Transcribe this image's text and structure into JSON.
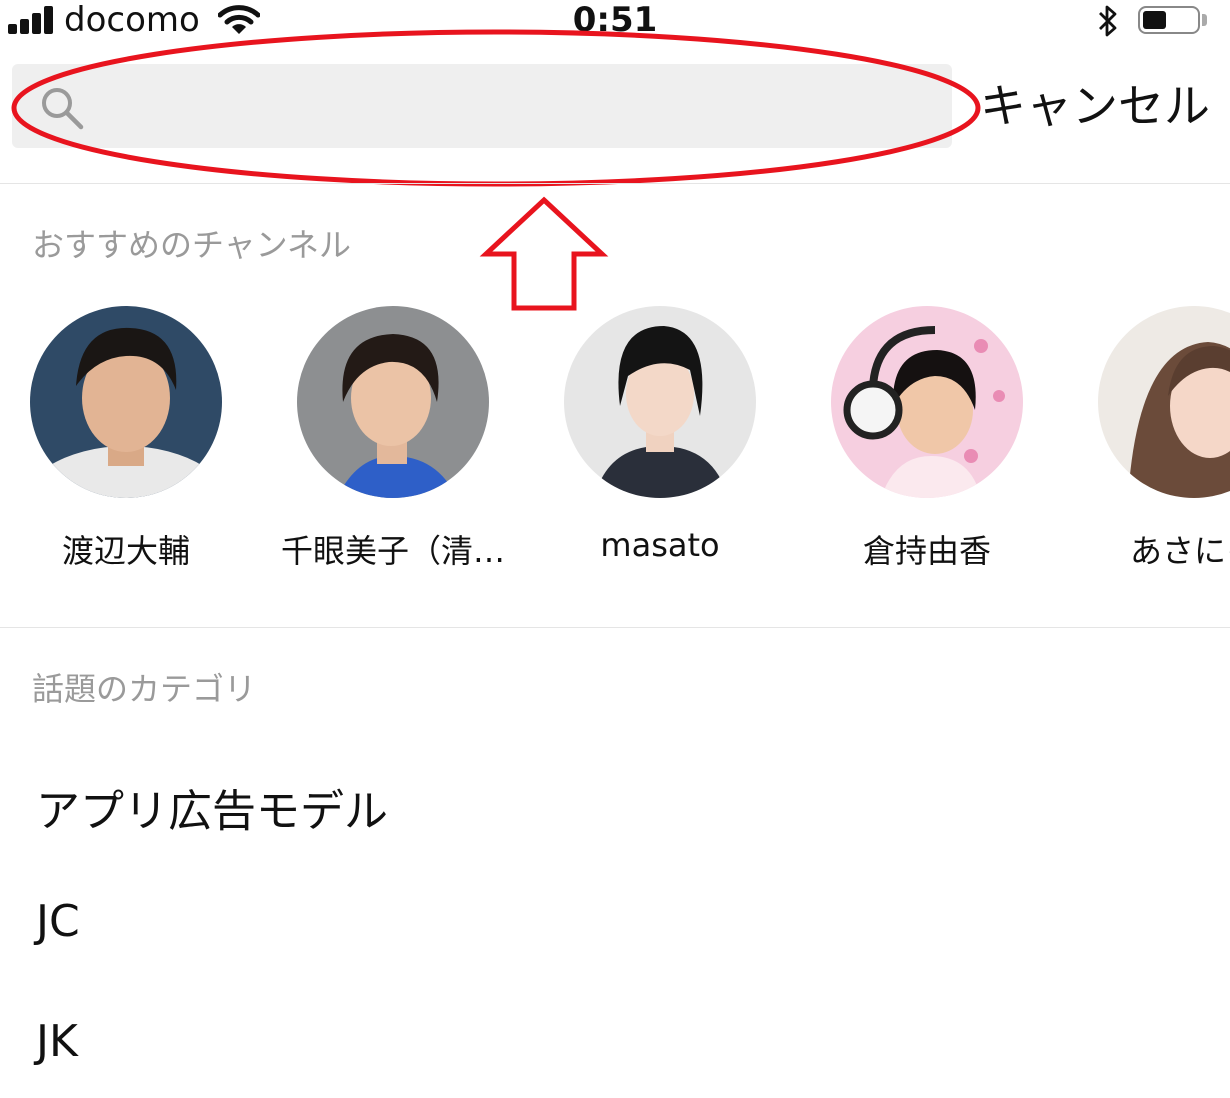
{
  "status_bar": {
    "carrier": "docomo",
    "time": "0:51",
    "battery_level": 0.45,
    "icons": [
      "signal-icon",
      "wifi-icon",
      "bluetooth-icon",
      "battery-icon"
    ]
  },
  "search": {
    "placeholder": "",
    "value": "",
    "cancel_label": "キャンセル"
  },
  "recommended": {
    "title": "おすすめのチャンネル",
    "channels": [
      {
        "name": "渡辺大輔"
      },
      {
        "name": "千眼美子（清…"
      },
      {
        "name": "masato"
      },
      {
        "name": "倉持由香"
      },
      {
        "name": "あさにゃ"
      }
    ]
  },
  "categories": {
    "title": "話題のカテゴリ",
    "items": [
      {
        "label": "アプリ広告モデル"
      },
      {
        "label": "JC"
      },
      {
        "label": "JK"
      }
    ]
  },
  "colors": {
    "annotation": "#e8141e",
    "search_bg": "#efefef",
    "section_title": "#9a9a9a"
  }
}
